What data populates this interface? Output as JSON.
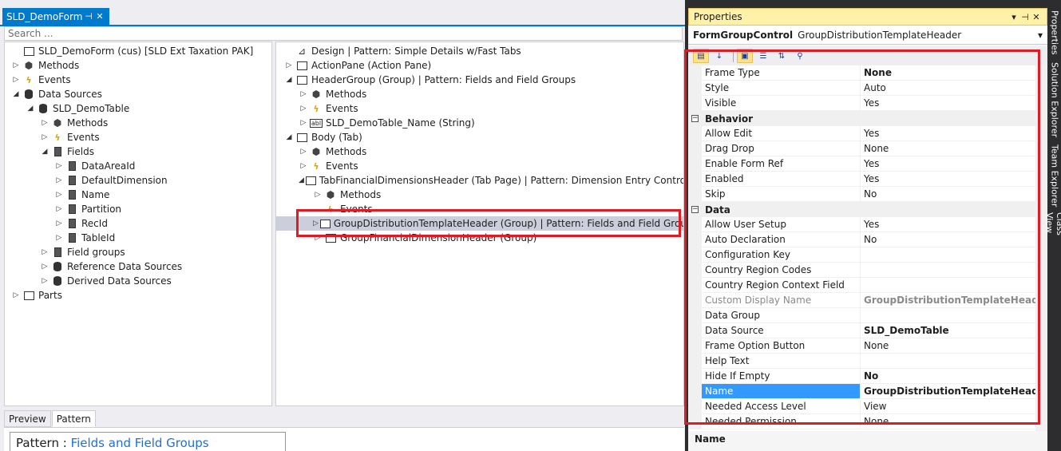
{
  "document": {
    "tab_title": "SLD_DemoForm",
    "pin_glyph": "⊣",
    "close_glyph": "✕",
    "search_placeholder": "Search ..."
  },
  "left_tree": [
    {
      "label": "SLD_DemoForm (cus) [SLD Ext Taxation PAK]",
      "icon": "form-icon",
      "level": 0,
      "arrow": ""
    },
    {
      "label": "Methods",
      "icon": "methods-icon",
      "level": 0,
      "arrow": "▷"
    },
    {
      "label": "Events",
      "icon": "events-icon",
      "level": 0,
      "arrow": "▷"
    },
    {
      "label": "Data Sources",
      "icon": "database-icon",
      "level": 0,
      "arrow": "◢"
    },
    {
      "label": "SLD_DemoTable",
      "icon": "database-icon",
      "level": 1,
      "arrow": "◢"
    },
    {
      "label": "Methods",
      "icon": "methods-icon",
      "level": 2,
      "arrow": "▷"
    },
    {
      "label": "Events",
      "icon": "events-icon",
      "level": 2,
      "arrow": "▷"
    },
    {
      "label": "Fields",
      "icon": "field-icon",
      "level": 2,
      "arrow": "◢"
    },
    {
      "label": "DataAreaId",
      "icon": "field-icon",
      "level": 3,
      "arrow": "▷"
    },
    {
      "label": "DefaultDimension",
      "icon": "field-icon",
      "level": 3,
      "arrow": "▷"
    },
    {
      "label": "Name",
      "icon": "field-icon",
      "level": 3,
      "arrow": "▷"
    },
    {
      "label": "Partition",
      "icon": "field-icon",
      "level": 3,
      "arrow": "▷"
    },
    {
      "label": "RecId",
      "icon": "field-icon",
      "level": 3,
      "arrow": "▷"
    },
    {
      "label": "TableId",
      "icon": "field-icon",
      "level": 3,
      "arrow": "▷"
    },
    {
      "label": "Field groups",
      "icon": "field-icon",
      "level": 2,
      "arrow": "▷"
    },
    {
      "label": "Reference Data Sources",
      "icon": "database-icon",
      "level": 2,
      "arrow": "▷"
    },
    {
      "label": "Derived Data Sources",
      "icon": "database-icon",
      "level": 2,
      "arrow": "▷"
    },
    {
      "label": "Parts",
      "icon": "parts-icon",
      "level": 0,
      "arrow": "▷"
    }
  ],
  "right_tree": [
    {
      "label": "Design | Pattern: Simple Details w/Fast Tabs",
      "icon": "design-icon",
      "level": 0,
      "arrow": ""
    },
    {
      "label": "ActionPane (Action Pane)",
      "icon": "actionpane-icon",
      "level": 0,
      "arrow": "▷"
    },
    {
      "label": "HeaderGroup (Group) | Pattern: Fields and Field Groups",
      "icon": "group-icon",
      "level": 0,
      "arrow": "◢"
    },
    {
      "label": "Methods",
      "icon": "methods-icon",
      "level": 1,
      "arrow": "▷"
    },
    {
      "label": "Events",
      "icon": "events-icon",
      "level": 1,
      "arrow": "▷"
    },
    {
      "label": "SLD_DemoTable_Name (String)",
      "icon": "string-icon",
      "level": 1,
      "arrow": "▷"
    },
    {
      "label": "Body (Tab)",
      "icon": "tab-icon",
      "level": 0,
      "arrow": "◢"
    },
    {
      "label": "Methods",
      "icon": "methods-icon",
      "level": 1,
      "arrow": "▷"
    },
    {
      "label": "Events",
      "icon": "events-icon",
      "level": 1,
      "arrow": "▷"
    },
    {
      "label": "TabFinancialDimensionsHeader (Tab Page) | Pattern: Dimension Entry Control",
      "icon": "tabpage-icon",
      "level": 1,
      "arrow": "◢"
    },
    {
      "label": "Methods",
      "icon": "methods-icon",
      "level": 2,
      "arrow": "▷"
    },
    {
      "label": "Events",
      "icon": "events-icon",
      "level": 2,
      "arrow": ""
    },
    {
      "label": "GroupDistributionTemplateHeader (Group) | Pattern: Fields and Field Groups",
      "icon": "group-icon",
      "level": 2,
      "arrow": "▷",
      "selected": true
    },
    {
      "label": "GroupFinancialDimensionHeader (Group)",
      "icon": "group-icon",
      "level": 2,
      "arrow": "▷"
    }
  ],
  "bottom": {
    "tabs": [
      "Preview",
      "Pattern"
    ],
    "active_tab": "Pattern",
    "pattern_prefix": "Pattern : ",
    "pattern_value": "Fields and Field Groups"
  },
  "properties": {
    "title": "Properties",
    "dropdown_glyph": "▾",
    "pin_glyph": "⊣",
    "close_glyph": "✕",
    "object_type": "FormGroupControl",
    "object_name": "GroupDistributionTemplateHeader",
    "rows": [
      {
        "name": "Frame Type",
        "value": "None",
        "bold": true
      },
      {
        "name": "Style",
        "value": "Auto"
      },
      {
        "name": "Visible",
        "value": "Yes"
      },
      {
        "category": "Behavior"
      },
      {
        "name": "Allow Edit",
        "value": "Yes"
      },
      {
        "name": "Drag Drop",
        "value": "None"
      },
      {
        "name": "Enable Form Ref",
        "value": "Yes"
      },
      {
        "name": "Enabled",
        "value": "Yes"
      },
      {
        "name": "Skip",
        "value": "No"
      },
      {
        "category": "Data"
      },
      {
        "name": "Allow User Setup",
        "value": "Yes"
      },
      {
        "name": "Auto Declaration",
        "value": "No"
      },
      {
        "name": "Configuration Key",
        "value": ""
      },
      {
        "name": "Country Region Codes",
        "value": ""
      },
      {
        "name": "Country Region Context Field",
        "value": ""
      },
      {
        "name": "Custom Display Name",
        "value": "GroupDistributionTemplateHeader (Gr",
        "dim": true,
        "bold": true
      },
      {
        "name": "Data Group",
        "value": ""
      },
      {
        "name": "Data Source",
        "value": "SLD_DemoTable",
        "bold": true
      },
      {
        "name": "Frame Option Button",
        "value": "None"
      },
      {
        "name": "Help Text",
        "value": ""
      },
      {
        "name": "Hide If Empty",
        "value": "No",
        "bold": true
      },
      {
        "name": "Name",
        "value": "GroupDistributionTemplateHeader",
        "bold": true,
        "selected": true
      },
      {
        "name": "Needed Access Level",
        "value": "View"
      },
      {
        "name": "Needed Permission",
        "value": "None"
      }
    ],
    "description_title": "Name"
  },
  "side_tabs": [
    "Properties",
    "Solution Explorer",
    "Team Explorer",
    "Class View"
  ],
  "colors": {
    "accent": "#007acc",
    "highlight_border": "#e01b24",
    "selection": "#3399ff",
    "title_yellow": "#fff1a8"
  }
}
